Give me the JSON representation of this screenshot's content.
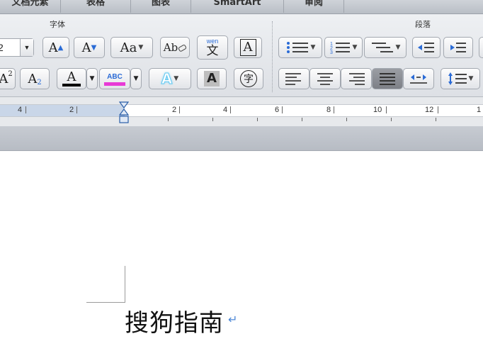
{
  "tabs": [
    "文档元素",
    "表格",
    "图表",
    "SmartArt",
    "审阅"
  ],
  "ribbon": {
    "font_group_title": "字体",
    "paragraph_group_title": "段落",
    "font_size_value": "2",
    "grow_font_label": "A",
    "shrink_font_label": "A",
    "change_case_label": "Aa",
    "clear_format_label": "Ab",
    "phonetic_top": "wen",
    "phonetic_char": "文",
    "char_border_label": "A",
    "superscript_label": "A",
    "superscript_mark": "2",
    "subscript_label": "A",
    "subscript_mark": "2",
    "font_color_label": "A",
    "highlight_label": "ABC",
    "text_effect_label": "A",
    "char_shading_label": "A",
    "enclose_char_label": "字",
    "font_color": "#000000",
    "highlight_color": "#e83ad6",
    "text_effect_color": "#5fc8f2"
  },
  "ruler": {
    "labels": [
      "4",
      "2",
      "2",
      "4",
      "6",
      "8",
      "10",
      "12",
      "1"
    ]
  },
  "document": {
    "text": "搜狗指南",
    "paragraph_mark": "↵"
  }
}
